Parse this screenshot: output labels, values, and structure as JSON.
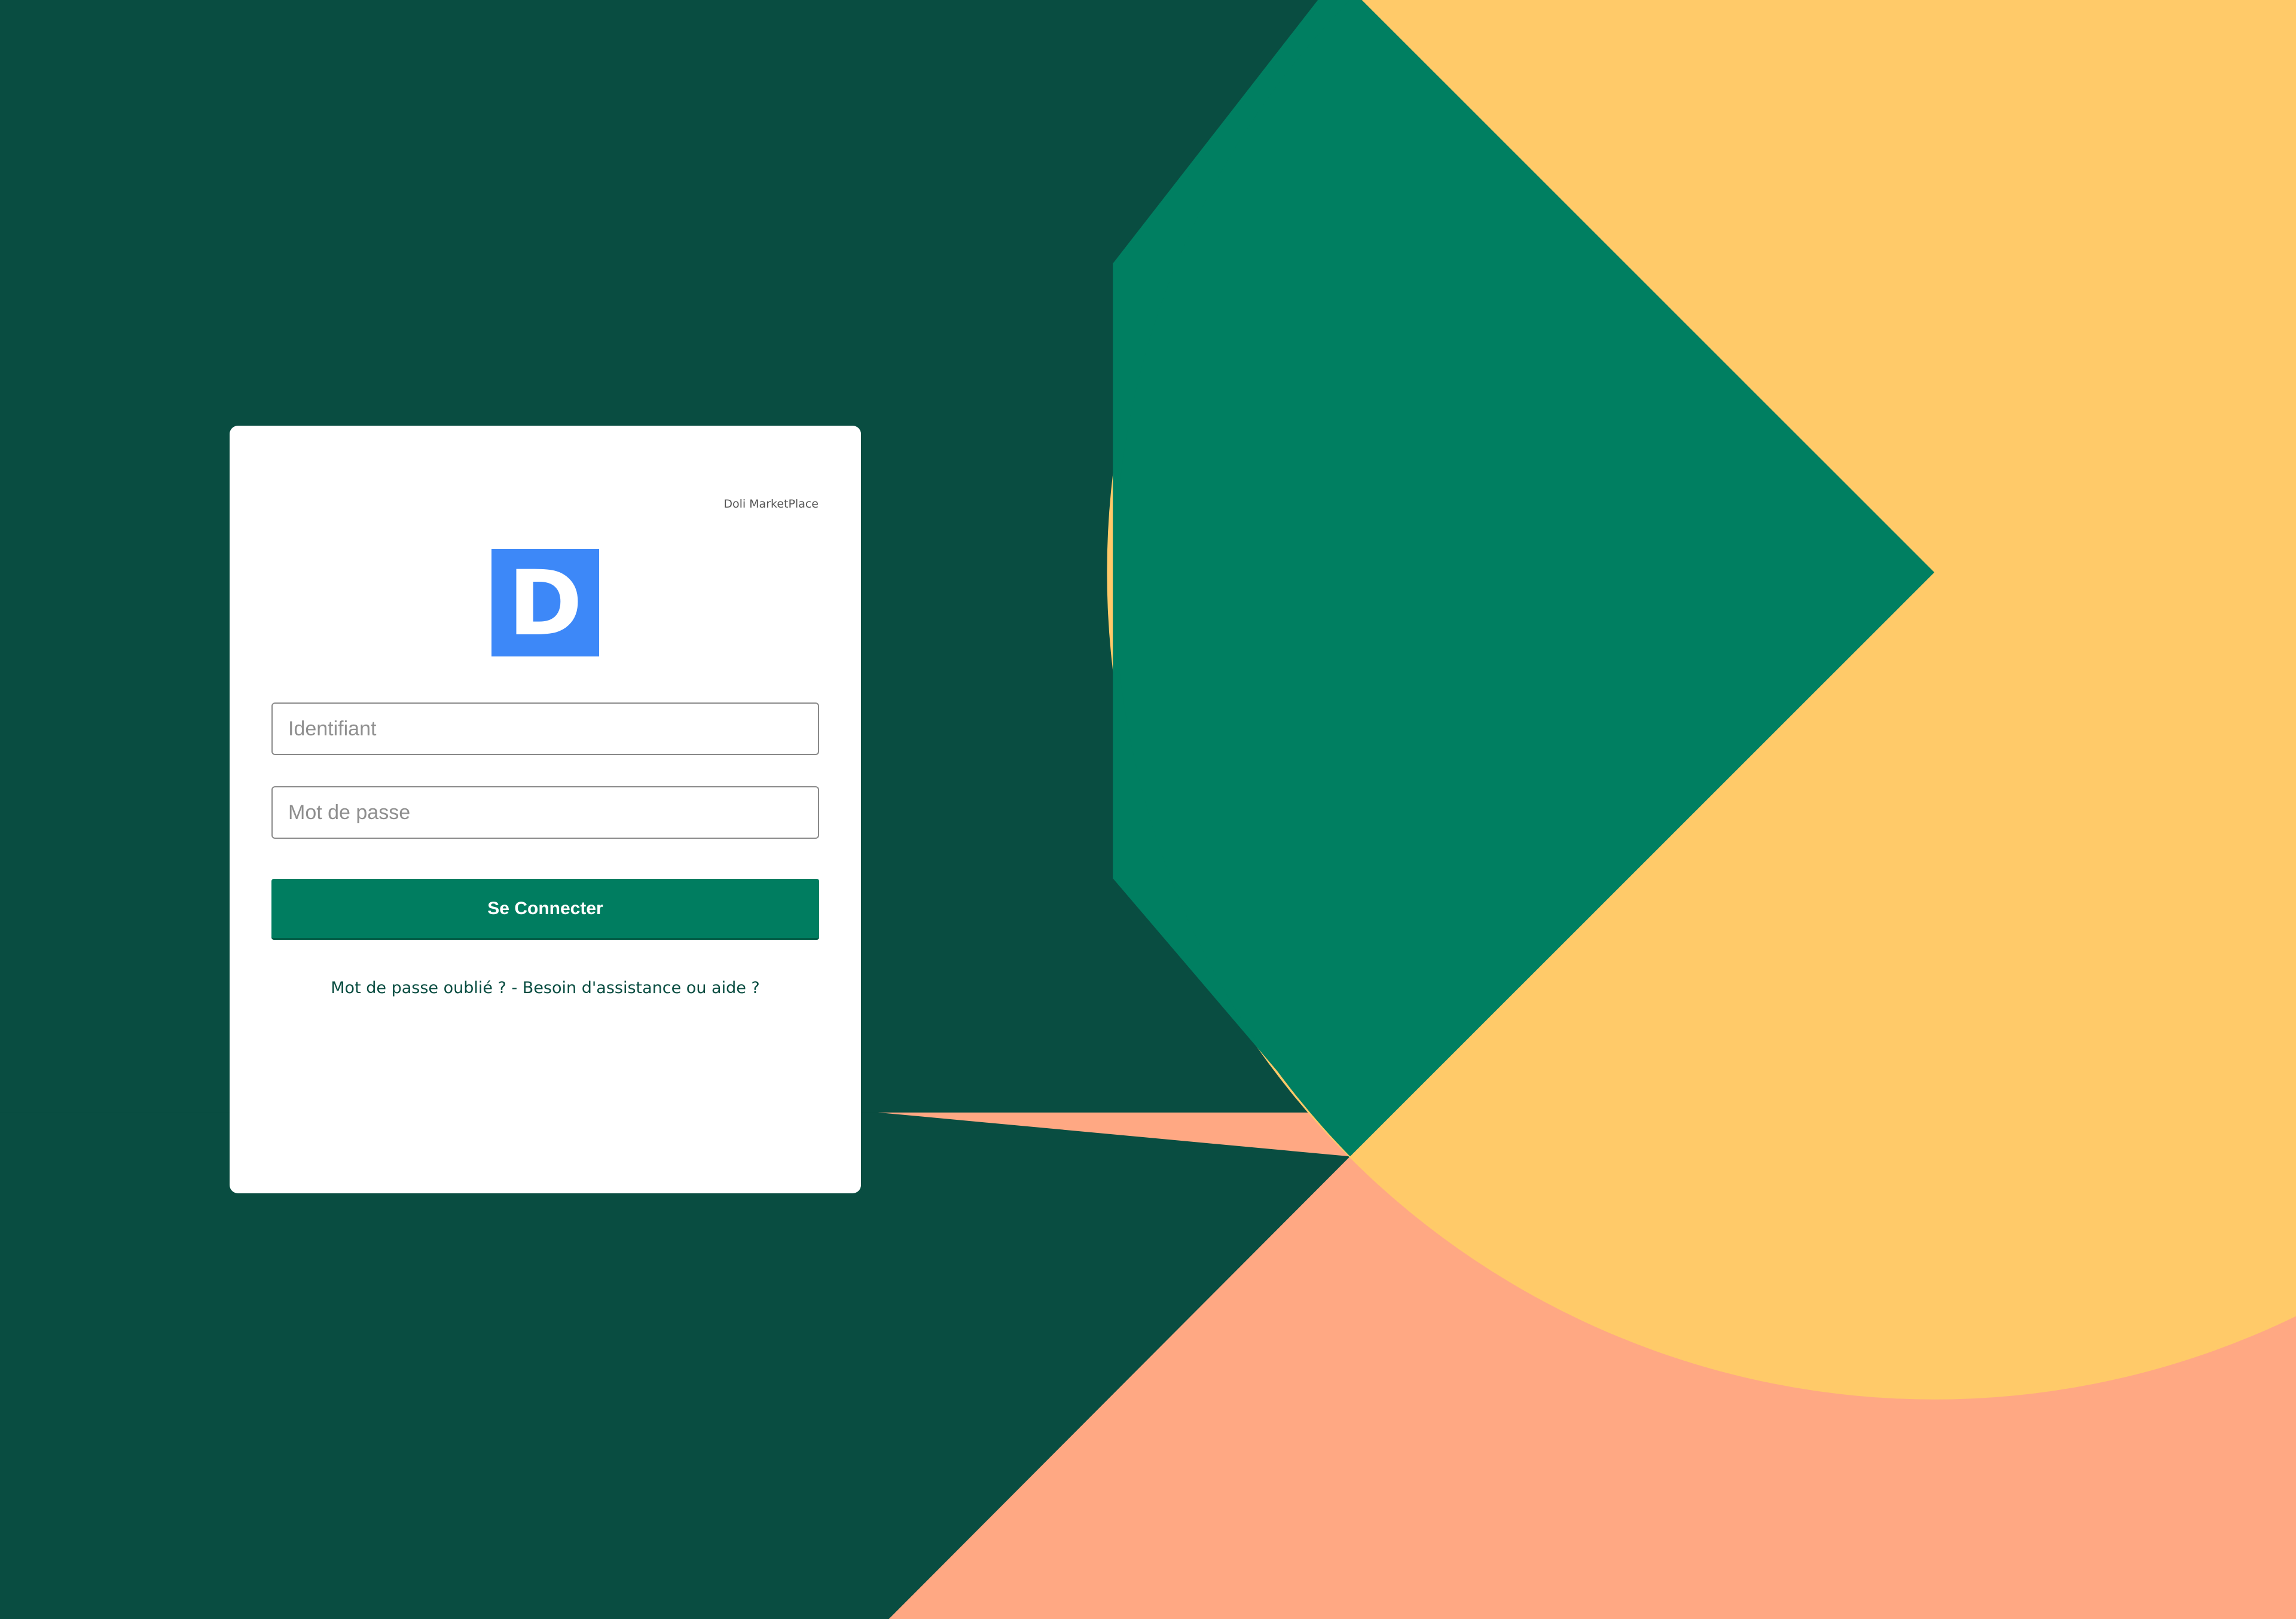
{
  "background": {
    "colors": {
      "dark_green": "#094d41",
      "green": "#007f61",
      "yellow": "#ffca69",
      "salmon": "#ffa883"
    }
  },
  "login": {
    "app_name": "Doli MarketPlace",
    "logo_letter": "D",
    "logo_color": "#3d88f8",
    "username_placeholder": "Identifiant",
    "password_placeholder": "Mot de passe",
    "submit_label": "Se Connecter",
    "forgot_password_label": "Mot de passe oublié ?",
    "separator": " - ",
    "help_label": "Besoin d'assistance ou aide ?"
  }
}
